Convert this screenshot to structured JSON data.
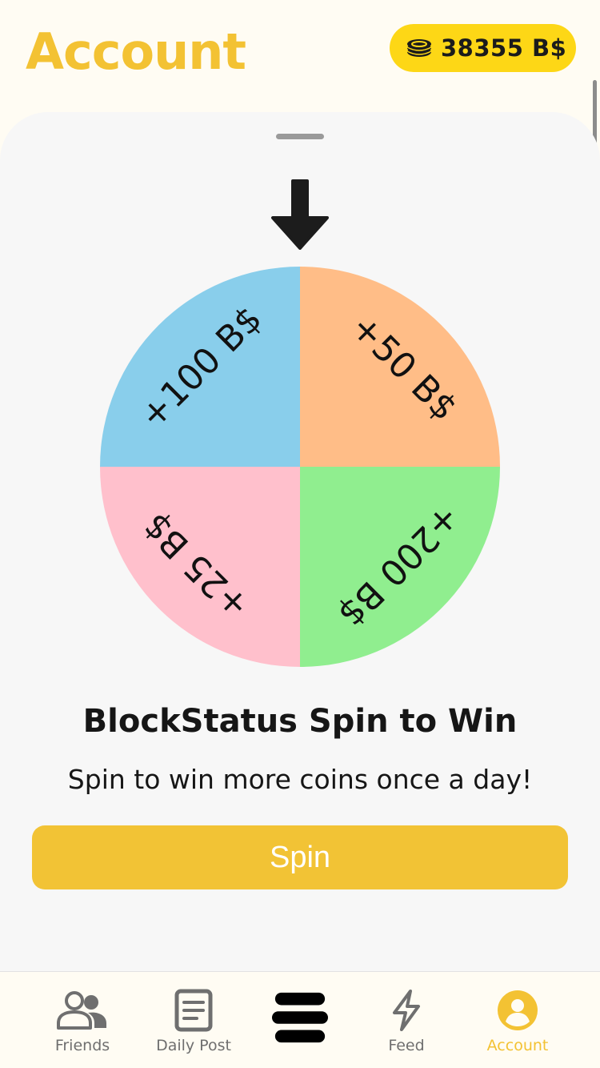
{
  "header": {
    "title": "Account",
    "balance": "38355 B$"
  },
  "wheel": {
    "segments": [
      {
        "label": "+100 B$",
        "color": "#89ceeb"
      },
      {
        "label": "+50 B$",
        "color": "#ffbd87"
      },
      {
        "label": "+200 B$",
        "color": "#90ee8f"
      },
      {
        "label": "+25 B$",
        "color": "#ffc0cc"
      }
    ]
  },
  "promo": {
    "title": "BlockStatus Spin to Win",
    "subtitle": "Spin to win more coins once a day!",
    "button_label": "Spin"
  },
  "tabbar": {
    "items": [
      {
        "label": "Friends",
        "icon": "friends-icon",
        "active": false
      },
      {
        "label": "Daily Post",
        "icon": "document-icon",
        "active": false
      },
      {
        "label": "",
        "icon": "blockstatus-logo-icon",
        "active": false
      },
      {
        "label": "Feed",
        "icon": "lightning-icon",
        "active": false
      },
      {
        "label": "Account",
        "icon": "account-icon",
        "active": true
      }
    ]
  },
  "colors": {
    "accent": "#f3c233",
    "badge": "#fdd716",
    "button": "#f2c335"
  }
}
